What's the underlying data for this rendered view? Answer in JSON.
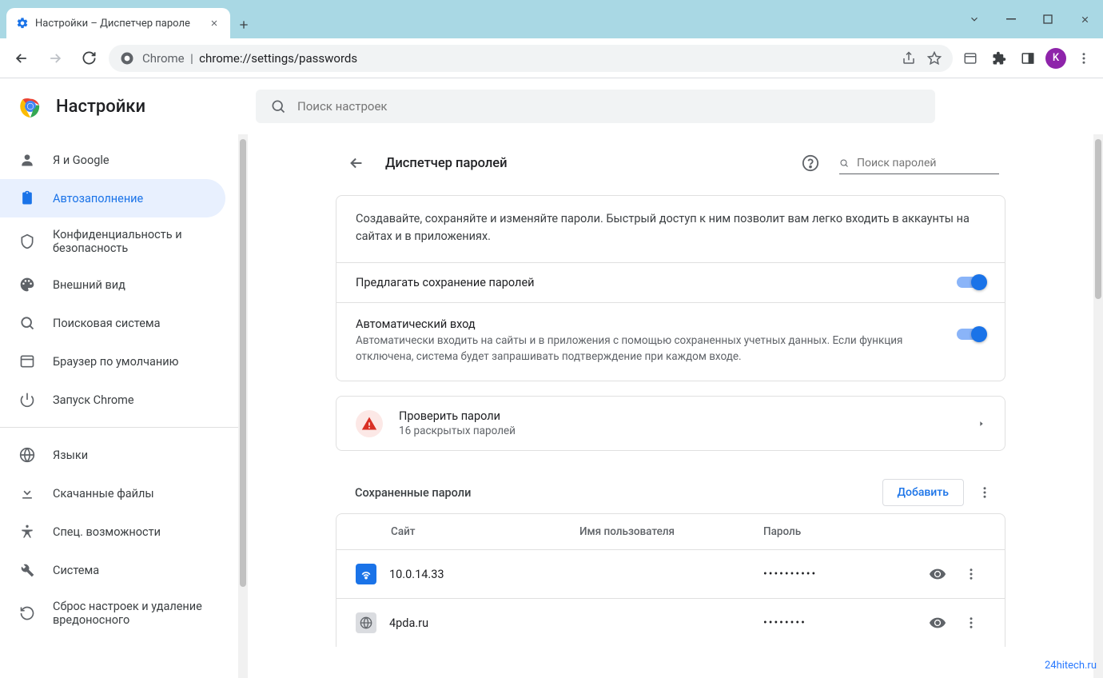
{
  "window": {
    "tab_title": "Настройки – Диспетчер пароле",
    "url_prefix": "Chrome",
    "url": "chrome://settings/passwords",
    "avatar_letter": "K"
  },
  "header": {
    "title": "Настройки",
    "search_placeholder": "Поиск настроек"
  },
  "sidebar": {
    "items": [
      {
        "label": "Я и Google"
      },
      {
        "label": "Автозаполнение"
      },
      {
        "label": "Конфиденциальность и безопасность"
      },
      {
        "label": "Внешний вид"
      },
      {
        "label": "Поисковая система"
      },
      {
        "label": "Браузер по умолчанию"
      },
      {
        "label": "Запуск Chrome"
      }
    ],
    "items2": [
      {
        "label": "Языки"
      },
      {
        "label": "Скачанные файлы"
      },
      {
        "label": "Спец. возможности"
      },
      {
        "label": "Система"
      },
      {
        "label": "Сброс настроек и удаление вредоносного"
      }
    ]
  },
  "main": {
    "section_title": "Диспетчер паролей",
    "pw_search_placeholder": "Поиск паролей",
    "description": "Создавайте, сохраняйте и изменяйте пароли. Быстрый доступ к ним позволит вам легко входить в аккаунты на сайтах и в приложениях.",
    "offer_save": "Предлагать сохранение паролей",
    "auto_signin_title": "Автоматический вход",
    "auto_signin_sub": "Автоматически входить на сайты и в приложения с помощью сохраненных учетных данных. Если функция отключена, система будет запрашивать подтверждение при каждом входе.",
    "check_title": "Проверить пароли",
    "check_sub": "16 раскрытых паролей",
    "saved_title": "Сохраненные пароли",
    "add_btn": "Добавить",
    "table": {
      "site": "Сайт",
      "user": "Имя пользователя",
      "pass": "Пароль"
    },
    "rows": [
      {
        "site": "10.0.14.33",
        "user": "",
        "pass": "••••••••••"
      },
      {
        "site": "4pda.ru",
        "user": "",
        "pass": "••••••••"
      }
    ]
  },
  "watermark": "24hitech.ru"
}
